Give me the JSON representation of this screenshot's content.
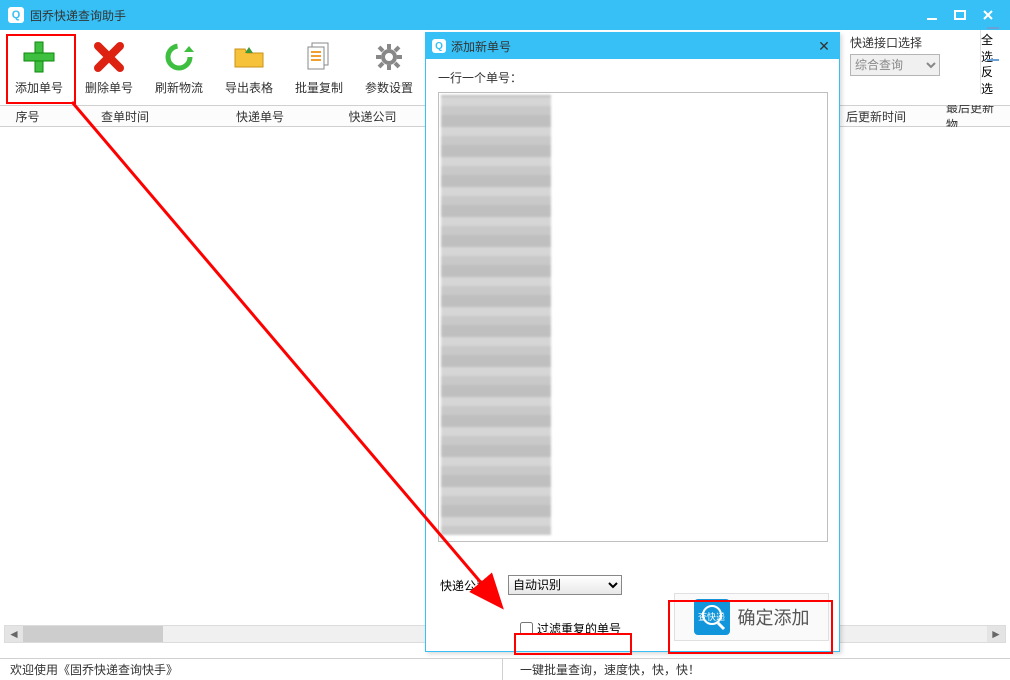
{
  "app": {
    "title": "固乔快递查询助手"
  },
  "toolbar": {
    "add": "添加单号",
    "delete": "删除单号",
    "refresh": "刷新物流",
    "export": "导出表格",
    "copy": "批量复制",
    "settings": "参数设置"
  },
  "interface": {
    "label": "快递接口选择",
    "value": "综合查询"
  },
  "side": {
    "select_all": "全选",
    "invert": "反选"
  },
  "columns": {
    "seq": "序号",
    "query_time": "查单时间",
    "track_no": "快递单号",
    "company": "快递公司",
    "last_update": "后更新时间",
    "last_info": "最后更新物"
  },
  "status": {
    "left": "欢迎使用《固乔快递查询快手》",
    "right": "一键批量查询，速度快，快，快！"
  },
  "dialog": {
    "title": "添加新单号",
    "hint": "一行一个单号：",
    "company_label": "快递公司：",
    "company_value": "自动识别",
    "filter_dup": "过滤重复的单号",
    "confirm": "确定添加",
    "search_badge": "查快递"
  }
}
